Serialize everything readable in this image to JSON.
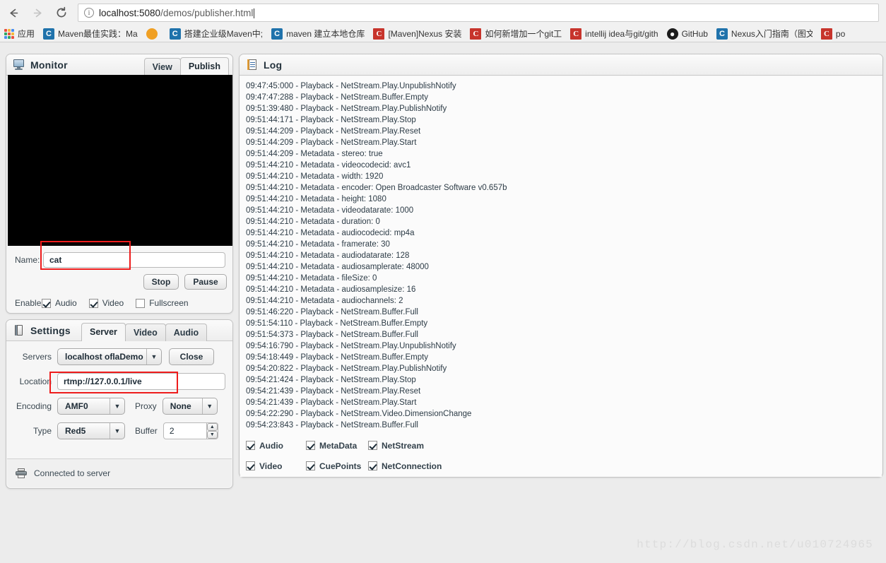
{
  "browser": {
    "back_label": "←",
    "forward_label": "→",
    "reload_label": "⟳",
    "url_host": "localhost:5080",
    "url_path": "/demos/publisher.html",
    "url_full": "localhost:5080/demos/publisher.html",
    "bookmarks": [
      {
        "label": "应用",
        "icon": "apps-grid-icon",
        "icon_kind": "apps",
        "glyph": ""
      },
      {
        "label": "Maven最佳实践：Ma",
        "icon": "cnblogs-icon",
        "icon_kind": "cnblog",
        "glyph": "C"
      },
      {
        "label": "",
        "icon": "smiley-icon",
        "icon_kind": "smile",
        "glyph": ""
      },
      {
        "label": "搭建企业级Maven中;",
        "icon": "cnblogs-icon",
        "icon_kind": "cnblog",
        "glyph": "C"
      },
      {
        "label": "maven 建立本地仓库",
        "icon": "cnblogs-icon",
        "icon_kind": "cnblog",
        "glyph": "C"
      },
      {
        "label": "[Maven]Nexus 安装",
        "icon": "csdn-icon",
        "icon_kind": "csdn",
        "glyph": "C"
      },
      {
        "label": "如何新增加一个git工",
        "icon": "csdn-icon",
        "icon_kind": "csdn",
        "glyph": "C"
      },
      {
        "label": "intellij idea与git/gith",
        "icon": "csdn-icon",
        "icon_kind": "csdn",
        "glyph": "C"
      },
      {
        "label": "GitHub",
        "icon": "github-icon",
        "icon_kind": "github",
        "glyph": "●"
      },
      {
        "label": "Nexus入门指南（图文",
        "icon": "cnblogs-icon",
        "icon_kind": "cnblog",
        "glyph": "C"
      },
      {
        "label": "po",
        "icon": "csdn-icon",
        "icon_kind": "csdn",
        "glyph": "C"
      }
    ]
  },
  "monitor": {
    "title": "Monitor",
    "tabs": [
      {
        "label": "View",
        "active": false
      },
      {
        "label": "Publish",
        "active": true
      }
    ],
    "name_label": "Name:",
    "name_value": "cat",
    "stop_label": "Stop",
    "pause_label": "Pause",
    "enable_label": "Enable:",
    "toggles": [
      {
        "label": "Audio",
        "checked": true
      },
      {
        "label": "Video",
        "checked": true
      },
      {
        "label": "Fullscreen",
        "checked": false
      }
    ]
  },
  "settings": {
    "title": "Settings",
    "tabs": [
      {
        "label": "Server",
        "active": true
      },
      {
        "label": "Video",
        "active": false
      },
      {
        "label": "Audio",
        "active": false
      }
    ],
    "servers_label": "Servers",
    "servers_value": "localhost oflaDemo",
    "close_label": "Close",
    "location_label": "Location",
    "location_value": "rtmp://127.0.0.1/live",
    "encoding_label": "Encoding",
    "encoding_value": "AMF0",
    "proxy_label": "Proxy",
    "proxy_value": "None",
    "type_label": "Type",
    "type_value": "Red5",
    "buffer_label": "Buffer",
    "buffer_value": "2",
    "status_text": "Connected to server"
  },
  "log": {
    "title": "Log",
    "lines": [
      "09:47:45:000 - Playback - NetStream.Play.UnpublishNotify",
      "09:47:47:288 - Playback - NetStream.Buffer.Empty",
      "09:51:39:480 - Playback - NetStream.Play.PublishNotify",
      "09:51:44:171 - Playback - NetStream.Play.Stop",
      "09:51:44:209 - Playback - NetStream.Play.Reset",
      "09:51:44:209 - Playback - NetStream.Play.Start",
      "09:51:44:209 - Metadata - stereo: true",
      "09:51:44:210 - Metadata - videocodecid: avc1",
      "09:51:44:210 - Metadata - width: 1920",
      "09:51:44:210 - Metadata - encoder: Open Broadcaster Software v0.657b",
      "09:51:44:210 - Metadata - height: 1080",
      "09:51:44:210 - Metadata - videodatarate: 1000",
      "09:51:44:210 - Metadata - duration: 0",
      "09:51:44:210 - Metadata - audiocodecid: mp4a",
      "09:51:44:210 - Metadata - framerate: 30",
      "09:51:44:210 - Metadata - audiodatarate: 128",
      "09:51:44:210 - Metadata - audiosamplerate: 48000",
      "09:51:44:210 - Metadata - fileSize: 0",
      "09:51:44:210 - Metadata - audiosamplesize: 16",
      "09:51:44:210 - Metadata - audiochannels: 2",
      "09:51:46:220 - Playback - NetStream.Buffer.Full",
      "09:51:54:110 - Playback - NetStream.Buffer.Empty",
      "09:51:54:373 - Playback - NetStream.Buffer.Full",
      "09:54:16:790 - Playback - NetStream.Play.UnpublishNotify",
      "09:54:18:449 - Playback - NetStream.Buffer.Empty",
      "09:54:20:822 - Playback - NetStream.Play.PublishNotify",
      "09:54:21:424 - Playback - NetStream.Play.Stop",
      "09:54:21:439 - Playback - NetStream.Play.Reset",
      "09:54:21:439 - Playback - NetStream.Play.Start",
      "09:54:22:290 - Playback - NetStream.Video.DimensionChange",
      "09:54:23:843 - Playback - NetStream.Buffer.Full"
    ],
    "filters": [
      {
        "label": "Audio",
        "checked": true
      },
      {
        "label": "MetaData",
        "checked": true
      },
      {
        "label": "NetStream",
        "checked": true
      },
      {
        "label": "Video",
        "checked": true
      },
      {
        "label": "CuePoints",
        "checked": true
      },
      {
        "label": "NetConnection",
        "checked": true
      }
    ]
  },
  "watermark": "http://blog.csdn.net/u010724965",
  "colors": {
    "annotation": "#ee1c1c",
    "panel_bg": "#f6f6f6",
    "page_bg": "#ececec",
    "video_bg": "#000000"
  }
}
